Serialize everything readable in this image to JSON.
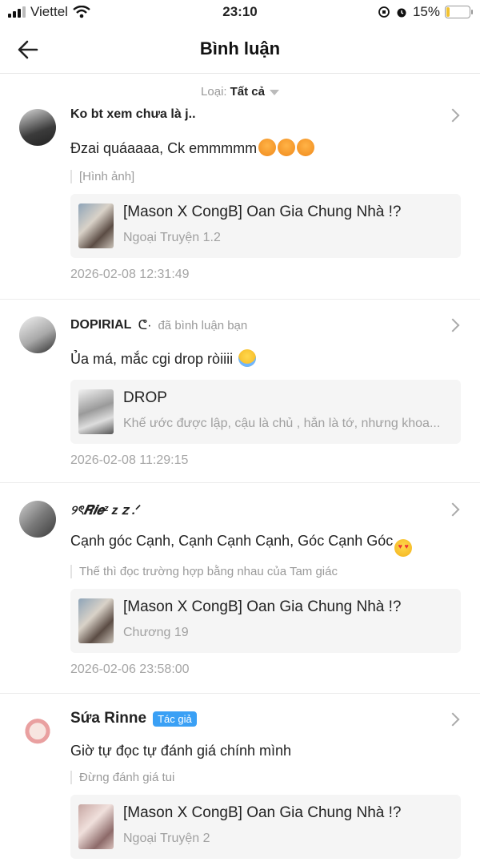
{
  "status_bar": {
    "carrier": "Viettel",
    "time": "23:10",
    "battery": "15%",
    "battery_level": 0.15
  },
  "header": {
    "title": "Bình luận"
  },
  "filter": {
    "label": "Loại:",
    "value": "Tất cả"
  },
  "comments": [
    {
      "user": "Ko bt xem chưa là j..",
      "text": "Đzai quáaaaa, Ck emmmmm",
      "emojis": [
        "angry-face",
        "angry-face",
        "angry-face"
      ],
      "quote": "[Hình ảnh]",
      "card_title": "[Mason X CongB] Oan Gia Chung Nhà !?",
      "card_sub": "Ngoại Truyện 1.2",
      "time": "2026-02-08 12:31:49"
    },
    {
      "user": "DOPIRIAL",
      "user_suffix": "ᕦ·",
      "sub": "đã bình luận bạn",
      "text": "Ủa má, mắc cgi drop ròiiii",
      "emojis": [
        "crying-face"
      ],
      "card_title": "DROP",
      "card_sub": "Khế ước được lập, cậu là chủ , hắn là tớ, nhưng khoa...",
      "time": "2026-02-08 11:29:15"
    },
    {
      "user": "୨ৎ𝑹𝒊𝒆ᶻ z 𝗓 .ᐟ",
      "text": "Cạnh góc Cạnh, Cạnh Cạnh Cạnh, Góc Cạnh Góc",
      "emojis": [
        "heart-eyes-face"
      ],
      "quote": "Thế thì đọc trường hợp bằng nhau của Tam giác",
      "card_title": "[Mason X CongB] Oan Gia Chung Nhà !?",
      "card_sub": "Chương 19",
      "time": "2026-02-06 23:58:00"
    },
    {
      "user": "Sứa Rinne",
      "badge": "Tác giả",
      "text": "Giờ tự đọc tự đánh giá chính mình",
      "quote": "Đừng đánh giá tui",
      "card_title": "[Mason X CongB] Oan Gia Chung Nhà !?",
      "card_sub": "Ngoại Truyện 2"
    }
  ]
}
